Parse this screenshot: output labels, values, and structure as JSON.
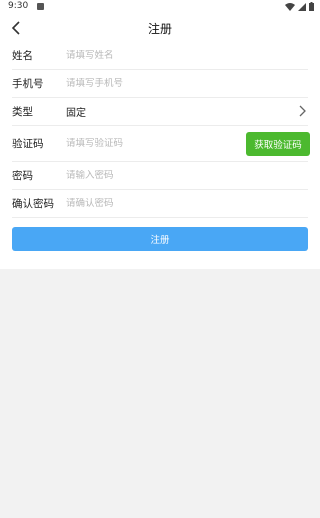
{
  "status_bar": {
    "time": "9:30"
  },
  "header": {
    "title": "注册"
  },
  "form": {
    "name": {
      "label": "姓名",
      "placeholder": "请填写姓名"
    },
    "phone": {
      "label": "手机号",
      "placeholder": "请填写手机号"
    },
    "type": {
      "label": "类型",
      "value": "固定"
    },
    "code": {
      "label": "验证码",
      "placeholder": "请填写验证码",
      "button": "获取验证码"
    },
    "password": {
      "label": "密码",
      "placeholder": "请输入密码"
    },
    "confirm": {
      "label": "确认密码",
      "placeholder": "请确认密码"
    }
  },
  "submit_label": "注册",
  "colors": {
    "get_code_button": "#4cb92f",
    "submit_button": "#49a7f5"
  },
  "icons": {
    "back": "chevron-left-icon",
    "type_arrow": "chevron-right-icon"
  }
}
